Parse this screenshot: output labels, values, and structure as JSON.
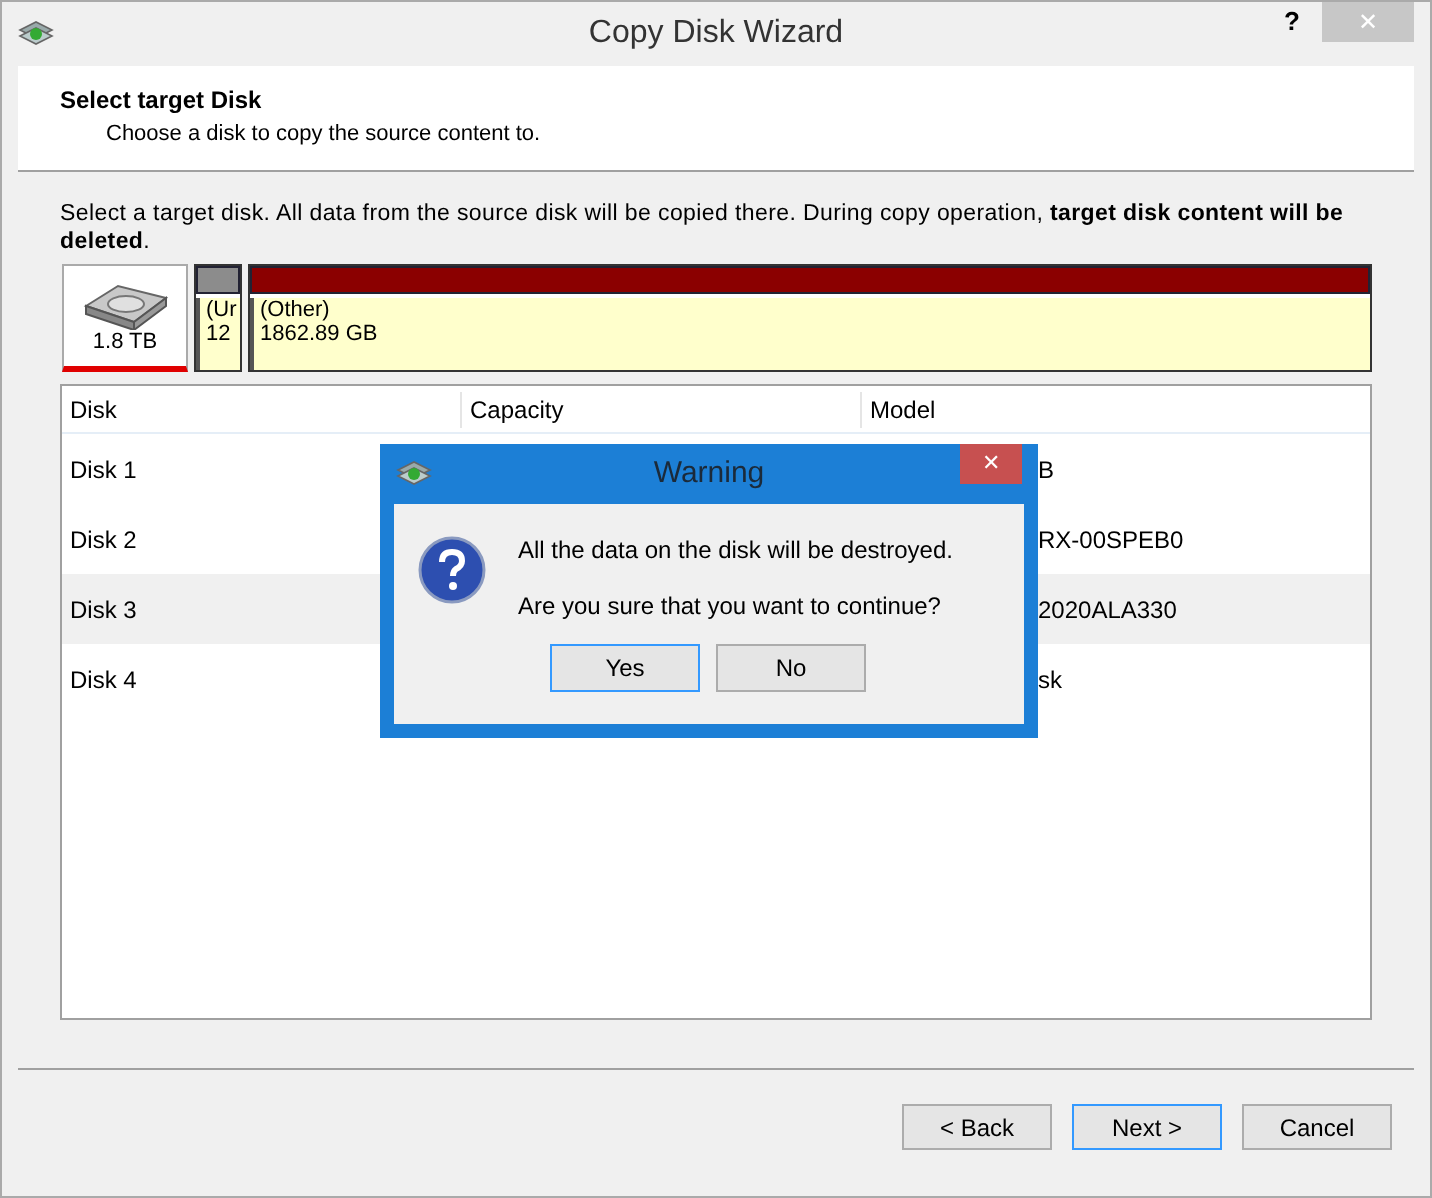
{
  "window": {
    "title": "Copy Disk Wizard",
    "help": "?",
    "close": "✕"
  },
  "header": {
    "title": "Select target Disk",
    "subtitle": "Choose a disk to copy the source content to."
  },
  "instruction": "Select a target disk. All data from the source disk will be copied there. During copy operation, **target disk content will be deleted**.",
  "disk_map": {
    "disk": {
      "label": "1.8 TB",
      "selected": true
    },
    "partitions": [
      {
        "name": "(Ur",
        "size": "12",
        "color": "#8c8c8c"
      },
      {
        "name": "(Other)",
        "size": "1862.89 GB",
        "color": "#8b0000"
      }
    ]
  },
  "table": {
    "columns": [
      "Disk",
      "Capacity",
      "Model"
    ],
    "rows": [
      {
        "disk": "Disk 1",
        "model": "B",
        "selected": false
      },
      {
        "disk": "Disk 2",
        "model": "RX-00SPEB0",
        "selected": false
      },
      {
        "disk": "Disk 3",
        "model": "2020ALA330",
        "selected": true
      },
      {
        "disk": "Disk 4",
        "model": "sk",
        "selected": false
      }
    ]
  },
  "dialog": {
    "title": "Warning",
    "close": "✕",
    "message": "All the data on the disk will be destroyed.",
    "question": "Are you sure that you want to continue?",
    "buttons": [
      {
        "label": "Yes",
        "selected": true
      },
      {
        "label": "No",
        "selected": false
      }
    ]
  },
  "buttons": [
    {
      "label": "< Back",
      "selected": false
    },
    {
      "label": "Next >",
      "selected": true
    },
    {
      "label": "Cancel",
      "selected": false
    }
  ]
}
